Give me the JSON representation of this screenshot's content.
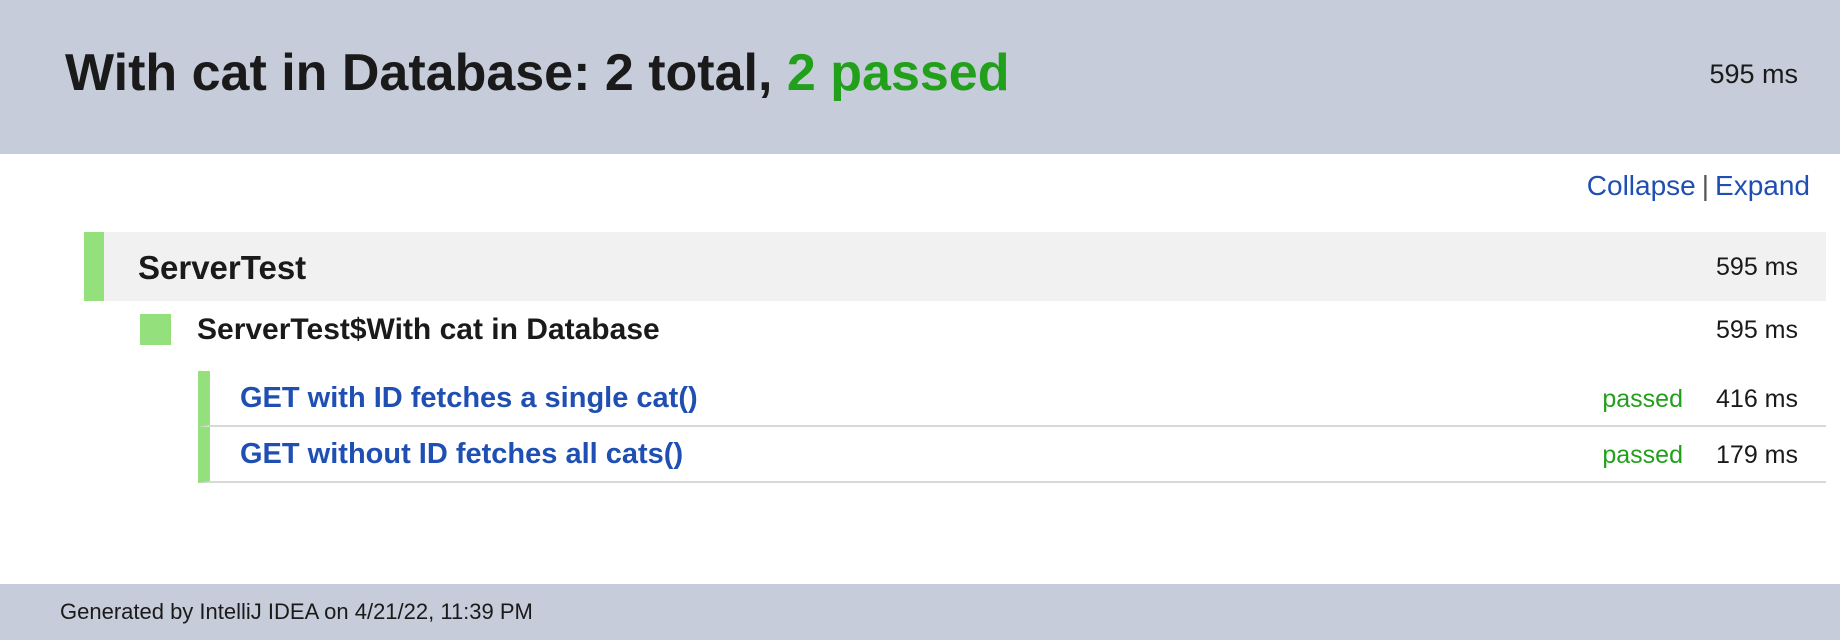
{
  "header": {
    "title_prefix": "With cat in Database: 2 total, ",
    "title_passed": "2 passed",
    "duration": "595 ms"
  },
  "controls": {
    "collapse": "Collapse",
    "separator": "|",
    "expand": "Expand"
  },
  "suite": {
    "name": "ServerTest",
    "duration": "595 ms"
  },
  "subsuite": {
    "name": "ServerTest$With cat in Database",
    "duration": "595 ms"
  },
  "tests": [
    {
      "name": "GET with ID fetches a single cat()",
      "status": "passed",
      "duration": "416 ms"
    },
    {
      "name": "GET without ID fetches all cats()",
      "status": "passed",
      "duration": "179 ms"
    }
  ],
  "footer": {
    "text": "Generated by IntelliJ IDEA on 4/21/22, 11:39 PM"
  },
  "colors": {
    "header_bg": "#c6ccd9",
    "passed": "#22a01b",
    "pass_marker": "#94e07d",
    "link": "#1f4fb3"
  }
}
